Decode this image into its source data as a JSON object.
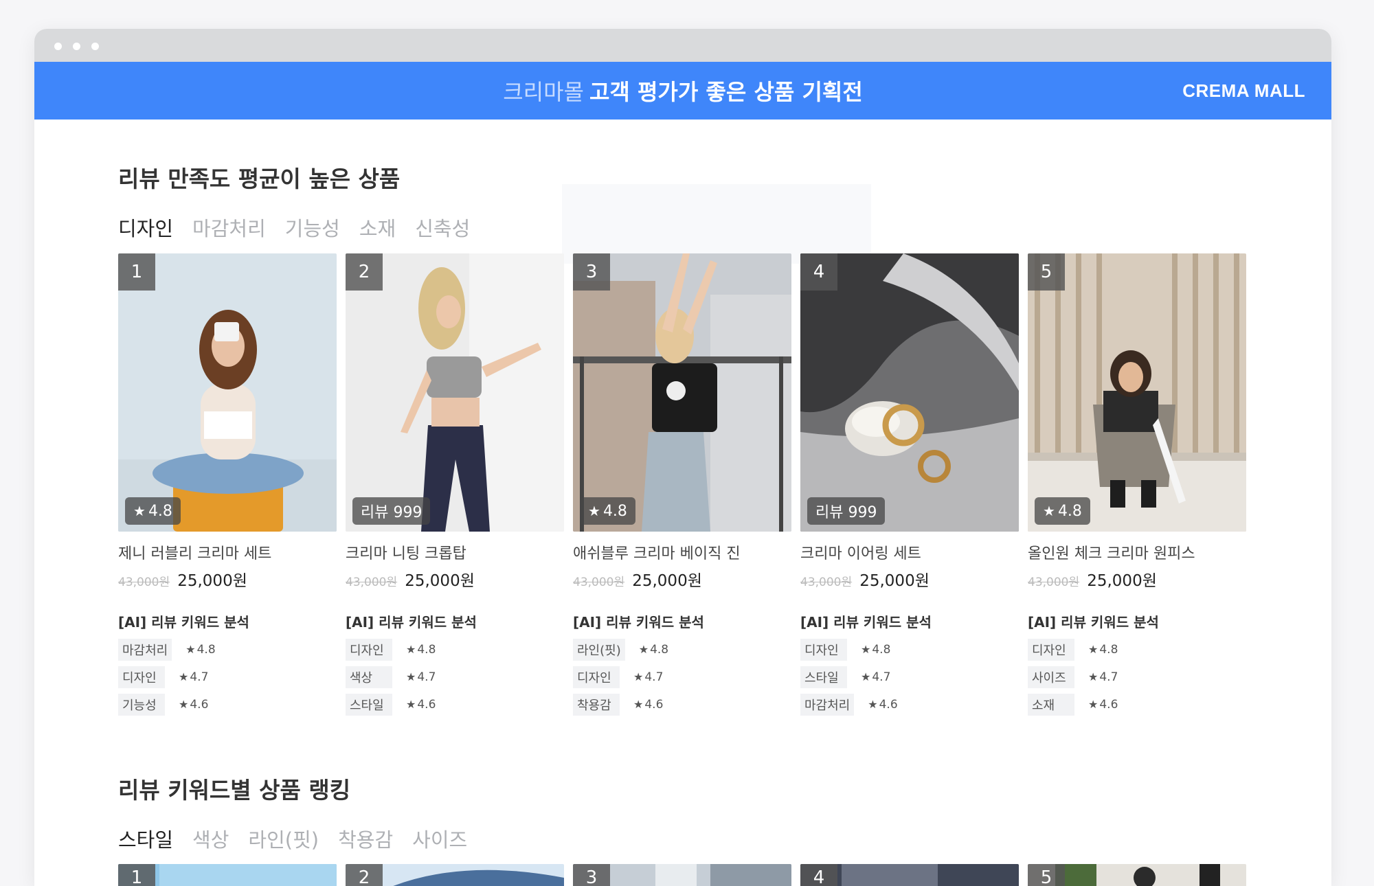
{
  "banner": {
    "prefix": "크리마몰",
    "title": "고객 평가가 좋은 상품 기획전",
    "brand": "CREMA MALL"
  },
  "section1": {
    "title": "리뷰 만족도 평균이 높은 상품",
    "tabs": [
      "디자인",
      "마감처리",
      "기능성",
      "소재",
      "신축성"
    ],
    "ai_label": "[AI] 리뷰 키워드 분석",
    "products": [
      {
        "rank": "1",
        "badge": "4.8",
        "badge_type": "star",
        "name": "제니 러블리 크리마 세트",
        "orig_price": "43,000원",
        "price": "25,000원",
        "keywords": [
          {
            "k": "마감처리",
            "s": "4.8"
          },
          {
            "k": "디자인",
            "s": "4.7"
          },
          {
            "k": "기능성",
            "s": "4.6"
          }
        ]
      },
      {
        "rank": "2",
        "badge": "리뷰 999",
        "badge_type": "text",
        "name": "크리마 니팅 크롭탑",
        "orig_price": "43,000원",
        "price": "25,000원",
        "keywords": [
          {
            "k": "디자인",
            "s": "4.8"
          },
          {
            "k": "색상",
            "s": "4.7"
          },
          {
            "k": "스타일",
            "s": "4.6"
          }
        ]
      },
      {
        "rank": "3",
        "badge": "4.8",
        "badge_type": "star",
        "name": "애쉬블루 크리마 베이직 진",
        "orig_price": "43,000원",
        "price": "25,000원",
        "keywords": [
          {
            "k": "라인(핏)",
            "s": "4.8"
          },
          {
            "k": "디자인",
            "s": "4.7"
          },
          {
            "k": "착용감",
            "s": "4.6"
          }
        ]
      },
      {
        "rank": "4",
        "badge": "리뷰 999",
        "badge_type": "text",
        "name": "크리마 이어링 세트",
        "orig_price": "43,000원",
        "price": "25,000원",
        "keywords": [
          {
            "k": "디자인",
            "s": "4.8"
          },
          {
            "k": "스타일",
            "s": "4.7"
          },
          {
            "k": "마감처리",
            "s": "4.6"
          }
        ]
      },
      {
        "rank": "5",
        "badge": "4.8",
        "badge_type": "star",
        "name": "올인원 체크 크리마 원피스",
        "orig_price": "43,000원",
        "price": "25,000원",
        "keywords": [
          {
            "k": "디자인",
            "s": "4.8"
          },
          {
            "k": "사이즈",
            "s": "4.7"
          },
          {
            "k": "소재",
            "s": "4.6"
          }
        ]
      }
    ]
  },
  "section2": {
    "title": "리뷰 키워드별 상품 랭킹",
    "tabs": [
      "스타일",
      "색상",
      "라인(핏)",
      "착용감",
      "사이즈"
    ],
    "ranks": [
      "1",
      "2",
      "3",
      "4",
      "5"
    ]
  },
  "colors": {
    "banner": "#3f86fa",
    "titlebar": "#d9dadc"
  }
}
